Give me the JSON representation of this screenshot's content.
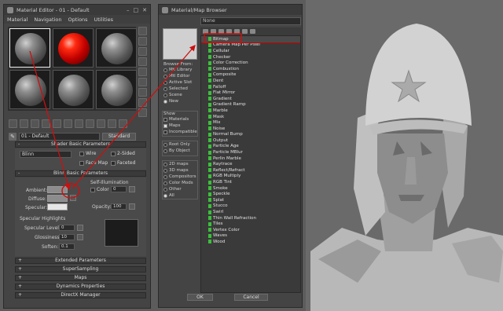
{
  "material_editor": {
    "title": "Material Editor - 01 - Default",
    "title_buttons": [
      "–",
      "□",
      "✕"
    ],
    "menu": [
      "Material",
      "Navigation",
      "Options",
      "Utilities"
    ],
    "material_name": "01 - Default",
    "type_button": "Standard",
    "rollouts": {
      "shader_basic": "Shader Basic Parameters",
      "blinn_basic": "Blinn Basic Parameters",
      "extended": "Extended Parameters",
      "supersampling": "SuperSampling",
      "maps": "Maps",
      "dynamics": "Dynamics Properties",
      "directx": "DirectX Manager"
    },
    "shader": {
      "type": "Blinn",
      "wire": "Wire",
      "two_sided": "2-Sided",
      "face_map": "Face Map",
      "faceted": "Faceted"
    },
    "blinn": {
      "ambient": "Ambient:",
      "diffuse": "Diffuse:",
      "specular": "Specular:",
      "self_illumination": "Self-Illumination",
      "color": "Color",
      "color_value": "0",
      "opacity": "Opacity:",
      "opacity_value": "100"
    },
    "specular_highlights": {
      "header": "Specular Highlights",
      "level_label": "Specular Level:",
      "level_value": "0",
      "gloss_label": "Glossiness:",
      "gloss_value": "10",
      "soften_label": "Soften:",
      "soften_value": "0.1"
    }
  },
  "map_browser": {
    "title": "Material/Map Browser",
    "search_value": "None",
    "browse_from_label": "Browse From:",
    "browse_from": [
      {
        "label": "Mtl Library",
        "on": false
      },
      {
        "label": "Mtl Editor",
        "on": false
      },
      {
        "label": "Active Slot",
        "on": false
      },
      {
        "label": "Selected",
        "on": false
      },
      {
        "label": "Scene",
        "on": false
      },
      {
        "label": "New",
        "on": true
      }
    ],
    "show_label": "Show",
    "show": [
      {
        "label": "Materials",
        "on": false
      },
      {
        "label": "Maps",
        "on": true
      },
      {
        "label": "Incompatible",
        "on": false
      }
    ],
    "root": [
      {
        "label": "Root Only",
        "on": false
      },
      {
        "label": "By Object",
        "on": false
      }
    ],
    "categories": [
      {
        "label": "2D maps",
        "on": false
      },
      {
        "label": "3D maps",
        "on": false
      },
      {
        "label": "Compositors",
        "on": false
      },
      {
        "label": "Color Mods",
        "on": false
      },
      {
        "label": "Other",
        "on": false
      },
      {
        "label": "All",
        "on": true
      }
    ],
    "maps": [
      "Bitmap",
      "Camera Map Per Pixel",
      "Cellular",
      "Checker",
      "Color Correction",
      "Combustion",
      "Composite",
      "Dent",
      "Falloff",
      "Flat Mirror",
      "Gradient",
      "Gradient Ramp",
      "Marble",
      "Mask",
      "Mix",
      "Noise",
      "Normal Bump",
      "Output",
      "Particle Age",
      "Particle MBlur",
      "Perlin Marble",
      "Raytrace",
      "Reflect/Refract",
      "RGB Multiply",
      "RGB Tint",
      "Smoke",
      "Speckle",
      "Splat",
      "Stucco",
      "Swirl",
      "Thin Wall Refraction",
      "Tiles",
      "Vertex Color",
      "Waves",
      "Wood"
    ],
    "selected_map": "Bitmap",
    "ok": "OK",
    "cancel": "Cancel"
  },
  "colors": {
    "highlight_red": "#cc1010",
    "sphere_red": "#ff2a10",
    "map_icon_green": "#3bbf3b"
  }
}
